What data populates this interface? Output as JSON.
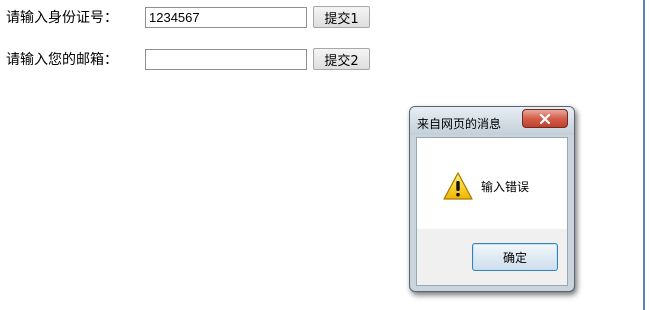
{
  "form": {
    "id_label": "请输入身份证号：",
    "id_value": "1234567",
    "submit1_label": "提交1",
    "email_label": "请输入您的邮箱：",
    "email_value": "",
    "submit2_label": "提交2"
  },
  "dialog": {
    "title": "来自网页的消息",
    "message": "输入错误",
    "ok_label": "确定",
    "icon": "warning-icon"
  },
  "colors": {
    "close_button": "#c8422d",
    "ok_border": "#3c7fb1",
    "warning_yellow": "#f5c400"
  }
}
